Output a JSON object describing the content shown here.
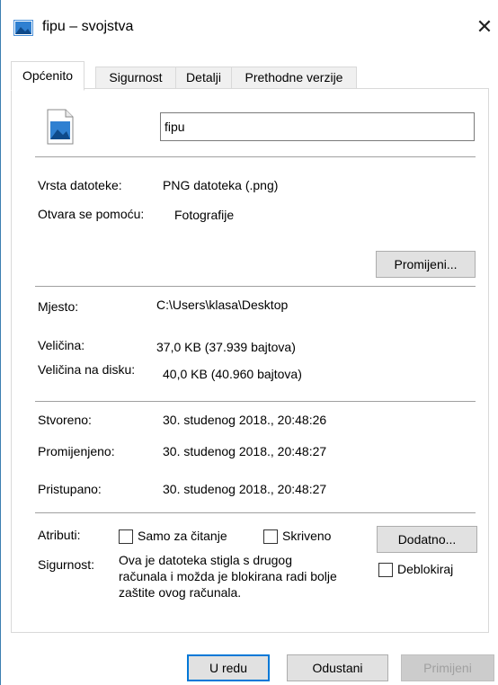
{
  "window": {
    "title": "fipu – svojstva",
    "close_glyph": "✕",
    "icon": "image-file-icon"
  },
  "tabs": [
    {
      "label": "Općenito",
      "active": true
    },
    {
      "label": "Sigurnost",
      "active": false
    },
    {
      "label": "Detalji",
      "active": false
    },
    {
      "label": "Prethodne verzije",
      "active": false
    }
  ],
  "general": {
    "file_name": "fipu",
    "type_label": "Vrsta datoteke:",
    "type_value": "PNG datoteka (.png)",
    "opens_with_label": "Otvara se pomoću:",
    "opens_with_value": "Fotografije",
    "change_button": "Promijeni...",
    "location_label": "Mjesto:",
    "location_value": "C:\\Users\\klasa\\Desktop",
    "size_label": "Veličina:",
    "size_value": "37,0 KB (37.939 bajtova)",
    "size_on_disk_label": "Veličina na disku:",
    "size_on_disk_value": "40,0 KB (40.960 bajtova)",
    "created_label": "Stvoreno:",
    "created_value": "30. studenog 2018., 20:48:26",
    "modified_label": "Promijenjeno:",
    "modified_value": "30. studenog 2018., 20:48:27",
    "accessed_label": "Pristupano:",
    "accessed_value": "30. studenog 2018., 20:48:27",
    "attributes_label": "Atributi:",
    "readonly_label": "Samo za čitanje",
    "readonly_checked": false,
    "hidden_label": "Skriveno",
    "hidden_checked": false,
    "advanced_button": "Dodatno...",
    "security_label": "Sigurnost:",
    "security_text": "Ova je datoteka stigla s drugog računala i možda je blokirana radi bolje zaštite ovog računala.",
    "unblock_label": "Deblokiraj",
    "unblock_checked": false
  },
  "footer": {
    "ok_button": "U redu",
    "cancel_button": "Odustani",
    "apply_button": "Primijeni"
  },
  "colors": {
    "accent": "#0078d7",
    "icon_blue": "#1e6fc7"
  }
}
